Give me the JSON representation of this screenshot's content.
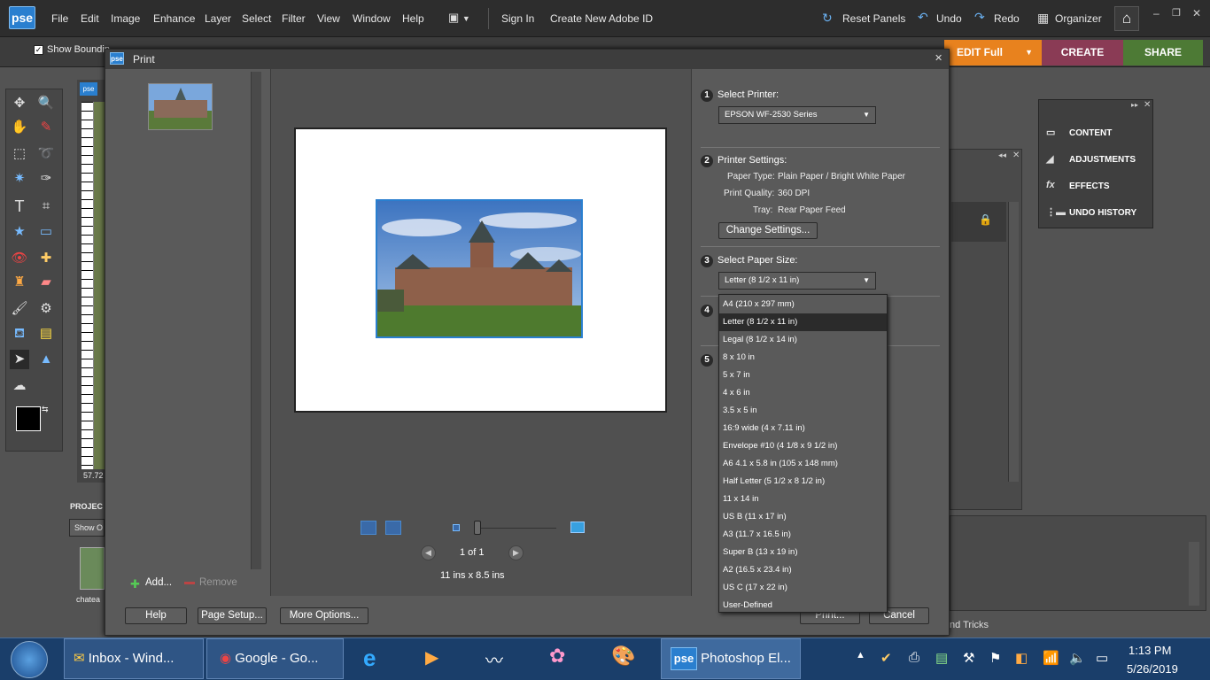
{
  "app": {
    "logo": "pse",
    "menu": [
      "File",
      "Edit",
      "Image",
      "Enhance",
      "Layer",
      "Select",
      "Filter",
      "View",
      "Window",
      "Help"
    ],
    "sign_in": "Sign In",
    "create_id": "Create New Adobe ID",
    "reset_panels": "Reset Panels",
    "undo": "Undo",
    "redo": "Redo",
    "organizer": "Organizer",
    "tabs": {
      "edit": "EDIT Full",
      "create": "CREATE",
      "share": "SHARE"
    },
    "option_show_bounding": "Show Boundin",
    "ruler_readout": "57.72",
    "project_label": "PROJEC",
    "show_label": "Show O",
    "thumb_label": "chatea",
    "tips_label": "nd Tricks"
  },
  "panels": {
    "items": [
      "CONTENT",
      "ADJUSTMENTS",
      "EFFECTS",
      "UNDO HISTORY"
    ]
  },
  "dialog": {
    "title": "Print",
    "add": "Add...",
    "remove": "Remove",
    "page_count": "1 of 1",
    "paper_dims": "11 ins x 8.5 ins",
    "buttons": {
      "help": "Help",
      "page_setup": "Page Setup...",
      "more_options": "More Options...",
      "print": "Print...",
      "cancel": "Cancel"
    },
    "steps": {
      "s1": {
        "num": "1",
        "label": "Select Printer:",
        "value": "EPSON WF-2530 Series"
      },
      "s2": {
        "num": "2",
        "label": "Printer Settings:",
        "paper_type_label": "Paper Type:",
        "paper_type": "Plain Paper / Bright White Paper",
        "quality_label": "Print Quality:",
        "quality": "360 DPI",
        "tray_label": "Tray:",
        "tray": "Rear Paper Feed",
        "change_button": "Change Settings..."
      },
      "s3": {
        "num": "3",
        "label": "Select Paper Size:",
        "value": "Letter (8 1/2 x 11 in)"
      },
      "s4": {
        "num": "4"
      },
      "s5": {
        "num": "5"
      }
    },
    "paper_options": [
      "A4 (210 x 297 mm)",
      "Letter (8 1/2 x 11 in)",
      "Legal (8 1/2 x 14 in)",
      "8 x 10 in",
      "5 x 7 in",
      "4 x 6 in",
      "3.5 x 5 in",
      "16:9 wide (4 x 7.11 in)",
      "Envelope #10 (4 1/8 x 9 1/2 in)",
      "A6 4.1 x 5.8 in (105 x 148 mm)",
      "Half Letter (5 1/2 x 8 1/2 in)",
      "11 x 14 in",
      "US B (11 x 17 in)",
      "A3 (11.7 x 16.5 in)",
      "Super B (13 x 19 in)",
      "A2 (16.5 x 23.4 in)",
      "US C (17 x 22 in)",
      "User-Defined"
    ],
    "selected_index": 1
  },
  "taskbar": {
    "tasks": [
      "Inbox - Wind...",
      "Google - Go...",
      "Photoshop El..."
    ],
    "photoshop_logo": "pse",
    "time": "1:13 PM",
    "date": "5/26/2019"
  },
  "colors": {
    "accent": "#e8821e",
    "create": "#8a3b55",
    "share": "#4d7a35",
    "selection": "#2b2b2b"
  }
}
